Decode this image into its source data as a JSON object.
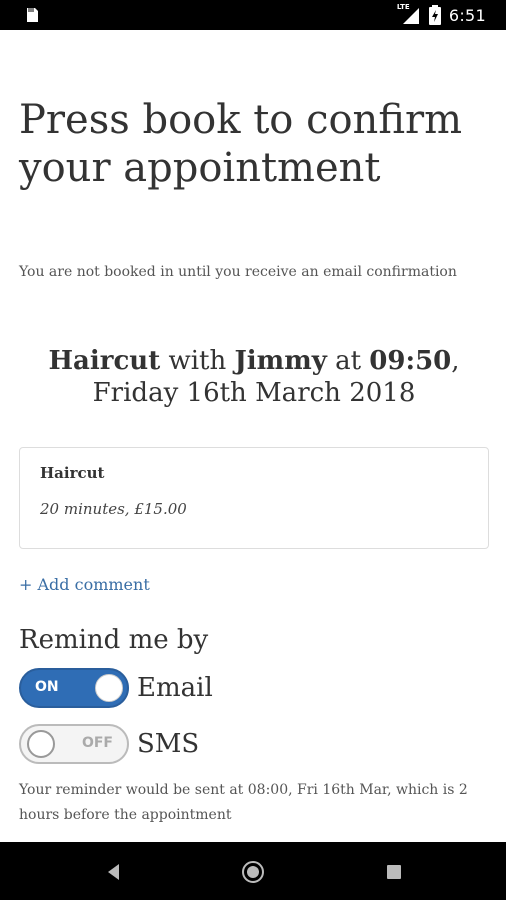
{
  "status_bar": {
    "time": "6:51",
    "network": "LTE",
    "icons": [
      "notification-icon",
      "signal-icon",
      "battery-icon"
    ]
  },
  "page": {
    "title": "Press book to confirm your appointment",
    "subtitle": "You are not booked in until you receive an email confirmation"
  },
  "booking": {
    "service": "Haircut",
    "with_word": "with",
    "staff": "Jimmy",
    "at_word": "at",
    "time": "09:50",
    "separator": ",",
    "date": "Friday 16th March 2018"
  },
  "service_card": {
    "name": "Haircut",
    "details": "20 minutes, £15.00"
  },
  "add_comment": "+ Add comment",
  "reminders": {
    "title": "Remind me by",
    "email": {
      "label": "Email",
      "state": "ON",
      "on": true
    },
    "sms": {
      "label": "SMS",
      "state": "OFF",
      "on": false
    },
    "note": "Your reminder would be sent at 08:00, Fri 16th Mar, which is 2 hours before the appointment"
  },
  "colors": {
    "accent": "#2f6db5",
    "link": "#3a6ea5",
    "text": "#333333"
  },
  "nav": [
    "back-icon",
    "home-icon",
    "recents-icon"
  ]
}
